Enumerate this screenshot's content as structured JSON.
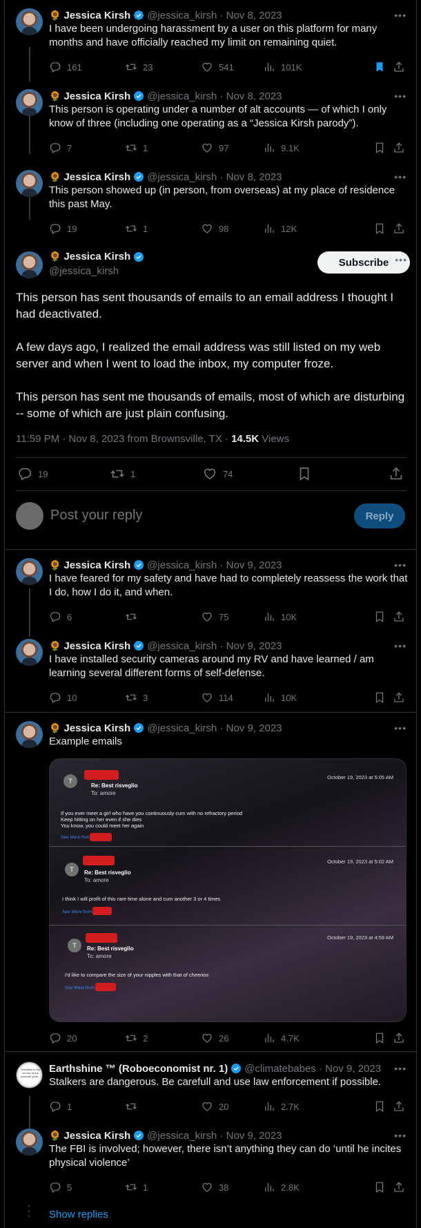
{
  "tweets": [
    {
      "sun": "🌻",
      "name": "Jessica Kirsh",
      "handle": "@jessica_kirsh",
      "date": "Nov 8, 2023",
      "text": "I have been undergoing harassment by a user on this platform for many months and have officially reached my limit on remaining quiet.",
      "replies": "161",
      "retweets": "23",
      "likes": "541",
      "views": "101K",
      "bookmarked": true
    },
    {
      "sun": "🌻",
      "name": "Jessica Kirsh",
      "handle": "@jessica_kirsh",
      "date": "Nov 8, 2023",
      "text": "This person is operating under a number of alt accounts — of which I only know of three (including one operating as a “Jessica Kirsh parody”).",
      "replies": "7",
      "retweets": "1",
      "likes": "97",
      "views": "9.1K"
    },
    {
      "sun": "🌻",
      "name": "Jessica Kirsh",
      "handle": "@jessica_kirsh",
      "date": "Nov 8, 2023",
      "text": "This person showed up (in person, from overseas) at my place of residence this past May.",
      "replies": "19",
      "retweets": "1",
      "likes": "98",
      "views": "12K"
    }
  ],
  "main": {
    "sun": "🌻",
    "name": "Jessica Kirsh",
    "handle": "@jessica_kirsh",
    "subscribe": "Subscribe",
    "p1": "This person has sent thousands of emails to an email address I thought I had deactivated.",
    "p2": "A few days ago, I realized the email address was still listed on my web server and when I went to load the inbox, my computer froze.",
    "p3": "This person has sent me thousands of emails, most of which are disturbing -- some of which are just plain confusing.",
    "meta": "11:59 PM · Nov 8, 2023 from Brownsville, TX · ",
    "views_count": "14.5K",
    "views_label": " Views",
    "replies": "19",
    "retweets": "1",
    "likes": "74"
  },
  "reply_box": {
    "placeholder": "Post your reply",
    "button": "Reply"
  },
  "tweets2": [
    {
      "sun": "🌻",
      "name": "Jessica Kirsh",
      "handle": "@jessica_kirsh",
      "date": "Nov 9, 2023",
      "text": "I have feared for my safety and have had to completely reassess the work that I do, how I do it, and when.",
      "replies": "6",
      "retweets": "",
      "likes": "75",
      "views": "10K"
    },
    {
      "sun": "🌻",
      "name": "Jessica Kirsh",
      "handle": "@jessica_kirsh",
      "date": "Nov 9, 2023",
      "text": "I have installed security cameras around my RV and have learned / am learning several different forms of self-defense.",
      "replies": "10",
      "retweets": "3",
      "likes": "114",
      "views": "10K"
    },
    {
      "sun": "🌻",
      "name": "Jessica Kirsh",
      "handle": "@jessica_kirsh",
      "date": "Nov 9, 2023",
      "text": "Example emails",
      "replies": "20",
      "retweets": "2",
      "likes": "26",
      "views": "4.7K"
    },
    {
      "sun": "",
      "name": "Earthshine ™ (Roboeconomist nr. 1)",
      "handle": "@climatebabes",
      "date": "Nov 9, 2023",
      "text": "Stalkers are dangerous. Be carefull and use law enforcement if possible.",
      "replies": "1",
      "retweets": "",
      "likes": "20",
      "views": "2.7K"
    },
    {
      "sun": "🌻",
      "name": "Jessica Kirsh",
      "handle": "@jessica_kirsh",
      "date": "Nov 9, 2023",
      "text": "The FBI is involved; however, there isn’t anything they can do ‘until he incites physical violence’",
      "replies": "5",
      "retweets": "1",
      "likes": "38",
      "views": "2.8K"
    }
  ],
  "emails": [
    {
      "avatar": "T",
      "subject": "Re: Best risveglio",
      "to": "To:  amore",
      "date": "October 19, 2023 at 5:05 AM",
      "message": "If you ever meet a girl who have you continuously cum with no refractory period\nKeep hitting on her even if she dies\nYou know, you could meet her again",
      "see_more": "See More from"
    },
    {
      "avatar": "T",
      "subject": "Re: Best risveglio",
      "to": "To:  amore",
      "date": "October 19, 2023 at 5:02 AM",
      "message": "I think I will profit of this rare time alone and cum another 3 or 4 times",
      "see_more": "See More from"
    },
    {
      "avatar": "T",
      "subject": "Re: Best risveglio",
      "to": "To:  amore",
      "date": "October 19, 2023 at 4:59 AM",
      "message": "I'd like to compare the size of your nipples with that of cheerios",
      "see_more": "See More from"
    }
  ],
  "earth_avatar_text": "Scientists in the service of the powerful grow...",
  "show_replies": "Show replies",
  "more_icon": "more-icon",
  "colors": {
    "accent": "#1d9bf0",
    "bg": "#000000",
    "muted": "#71767b"
  }
}
